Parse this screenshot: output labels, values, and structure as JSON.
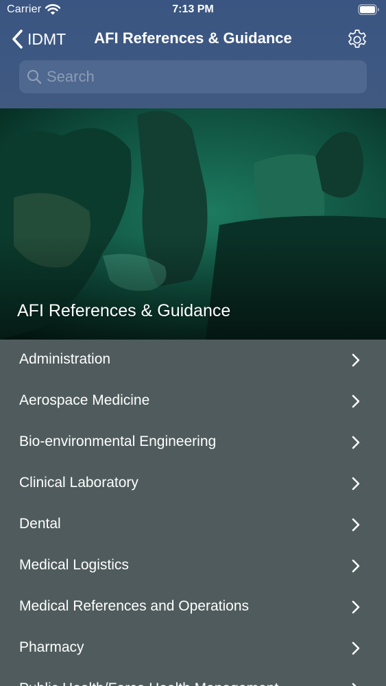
{
  "status_bar": {
    "carrier": "Carrier",
    "time": "7:13 PM"
  },
  "nav": {
    "back_label": "IDMT",
    "title": "AFI References & Guidance"
  },
  "search": {
    "placeholder": "Search",
    "value": ""
  },
  "hero": {
    "title": "AFI References & Guidance"
  },
  "list": {
    "items": [
      {
        "label": "Administration"
      },
      {
        "label": "Aerospace Medicine"
      },
      {
        "label": "Bio-environmental Engineering"
      },
      {
        "label": "Clinical Laboratory"
      },
      {
        "label": "Dental"
      },
      {
        "label": "Medical Logistics"
      },
      {
        "label": "Medical References and Operations"
      },
      {
        "label": "Pharmacy"
      },
      {
        "label": "Public Health/Force Health Management"
      }
    ]
  },
  "colors": {
    "header": "#3a5581",
    "list_background": "#4f5b5c",
    "hero_tint": "#0f5a46"
  },
  "icons": [
    "wifi-icon",
    "battery-icon",
    "back-chevron-icon",
    "gear-icon",
    "search-icon",
    "chevron-right-icon"
  ]
}
